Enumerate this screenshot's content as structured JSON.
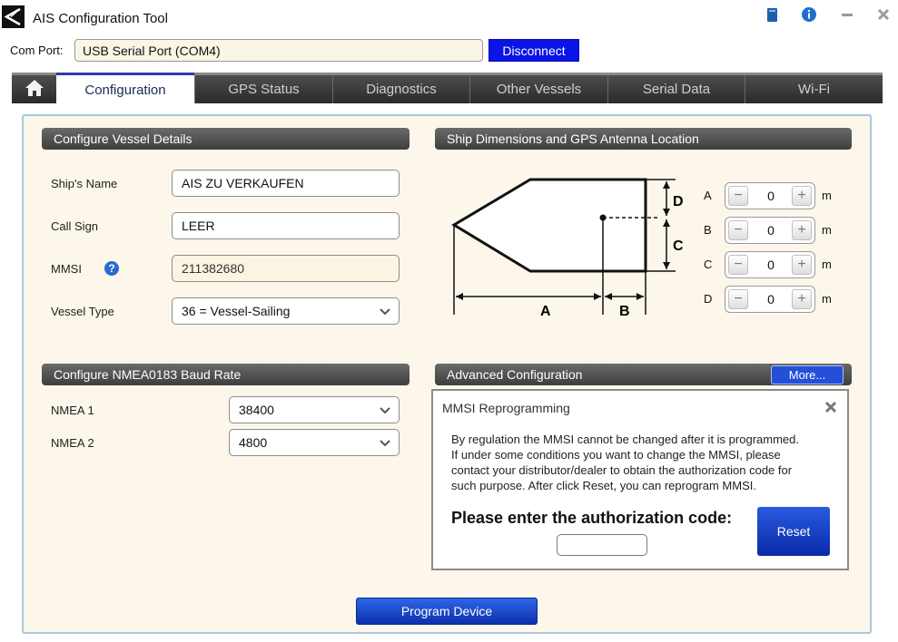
{
  "window": {
    "title": "AIS Configuration Tool",
    "icons": [
      "app-logo-icon",
      "book-icon",
      "info-icon",
      "minimize-icon",
      "close-icon"
    ]
  },
  "comport": {
    "label": "Com Port:",
    "value": "USB Serial Port (COM4)",
    "button_label": "Disconnect"
  },
  "tabs": [
    {
      "label": "Configuration",
      "active": true
    },
    {
      "label": "GPS Status"
    },
    {
      "label": "Diagnostics"
    },
    {
      "label": "Other Vessels"
    },
    {
      "label": "Serial Data"
    },
    {
      "label": "Wi-Fi"
    }
  ],
  "vessel": {
    "header": "Configure Vessel Details",
    "ship_name_label": "Ship's Name",
    "ship_name": "AIS ZU VERKAUFEN",
    "call_sign_label": "Call Sign",
    "call_sign": "LEER",
    "mmsi_label": "MMSI",
    "mmsi_help": "?",
    "mmsi": "211382680",
    "vessel_type_label": "Vessel Type",
    "vessel_type": "36 = Vessel-Sailing"
  },
  "dimensions": {
    "header": "Ship Dimensions and GPS Antenna Location",
    "diagram_labels": {
      "a": "A",
      "b": "B",
      "c": "C",
      "d": "D"
    },
    "unit": "m",
    "rows": [
      {
        "letter": "A",
        "value": "0"
      },
      {
        "letter": "B",
        "value": "0"
      },
      {
        "letter": "C",
        "value": "0"
      },
      {
        "letter": "D",
        "value": "0"
      }
    ]
  },
  "nmea": {
    "header": "Configure NMEA0183 Baud Rate",
    "nmea1_label": "NMEA 1",
    "nmea1_value": "38400",
    "nmea2_label": "NMEA 2",
    "nmea2_value": "4800"
  },
  "advanced": {
    "header": "Advanced Configuration",
    "more_label": "More..."
  },
  "dialog": {
    "title": "MMSI Reprogramming",
    "line1": "By regulation the MMSI cannot be changed after it is programmed.",
    "line2": "If under some conditions you want to change the MMSI, please",
    "line3": "contact your distributor/dealer to obtain the authorization code for",
    "line4": "such purpose. After click Reset, you can reprogram MMSI.",
    "prompt": "Please enter the authorization code:",
    "code_value": "",
    "reset_label": "Reset"
  },
  "program_label": "Program Device",
  "colors": {
    "accent_blue": "#0a14e6",
    "panel_bg": "#fcf7ea",
    "header_dark": "#3e3e3e"
  }
}
